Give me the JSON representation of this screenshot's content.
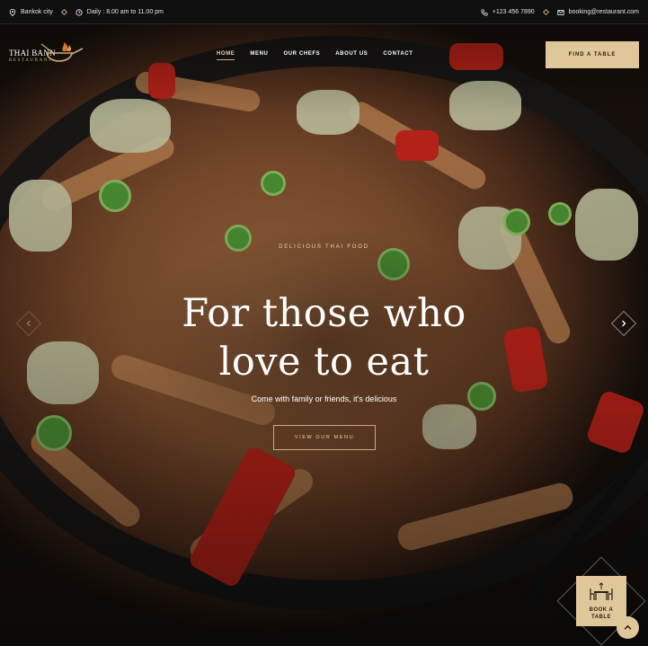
{
  "topbar": {
    "location": "Bankok city",
    "hours": "Daily : 8.00 am to 11.00 pm",
    "phone": "+123 456 7890",
    "email": "booking@restaurant.com"
  },
  "logo": {
    "name": "THAI BANN",
    "subtitle": "RESTAURANT"
  },
  "nav": {
    "items": [
      "HOME",
      "MENU",
      "OUR CHEFS",
      "ABOUT US",
      "CONTACT"
    ],
    "active": "HOME"
  },
  "header": {
    "cta_label": "FIND A TABLE"
  },
  "hero": {
    "eyebrow": "DELICIOUS THAI FOOD",
    "headline_line1": "For those who",
    "headline_line2": "love to eat",
    "subline": "Come with family or friends, it's delicious",
    "button_label": "VIEW OUR MENU"
  },
  "book_widget": {
    "label_line1": "BOOK A",
    "label_line2": "TABLE"
  },
  "colors": {
    "accent": "#e0c79a",
    "accent_dark": "#c9ab7a",
    "topbar_bg": "#0f0f0f"
  },
  "icons": [
    "location-pin-icon",
    "clock-icon",
    "phone-icon",
    "mail-icon",
    "wok-logo-icon",
    "chevron-right-icon",
    "chevron-left-icon",
    "dining-table-icon",
    "chevron-up-icon"
  ]
}
